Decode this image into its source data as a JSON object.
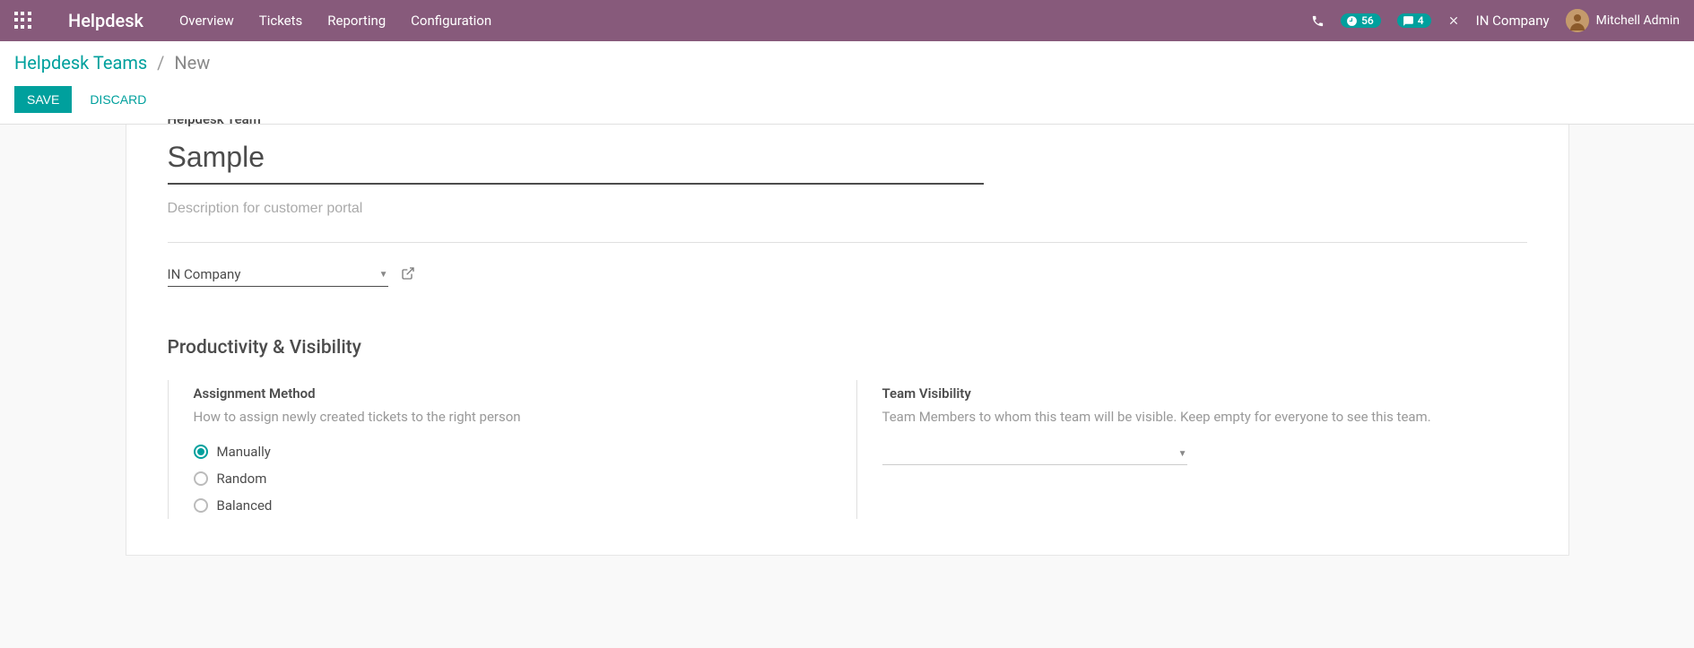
{
  "navbar": {
    "app_title": "Helpdesk",
    "menu": [
      "Overview",
      "Tickets",
      "Reporting",
      "Configuration"
    ],
    "timer_badge": "56",
    "chat_badge": "4",
    "company": "IN Company",
    "user_name": "Mitchell Admin"
  },
  "breadcrumb": {
    "parent": "Helpdesk Teams",
    "current": "New"
  },
  "buttons": {
    "save": "Save",
    "discard": "Discard"
  },
  "form": {
    "team_label": "Helpdesk Team",
    "name_value": "Sample",
    "description_placeholder": "Description for customer portal",
    "company_value": "IN Company",
    "section_title": "Productivity & Visibility",
    "assignment": {
      "label": "Assignment Method",
      "desc": "How to assign newly created tickets to the right person",
      "options": [
        "Manually",
        "Random",
        "Balanced"
      ],
      "selected": "Manually"
    },
    "visibility": {
      "label": "Team Visibility",
      "desc": "Team Members to whom this team will be visible. Keep empty for everyone to see this team."
    }
  }
}
